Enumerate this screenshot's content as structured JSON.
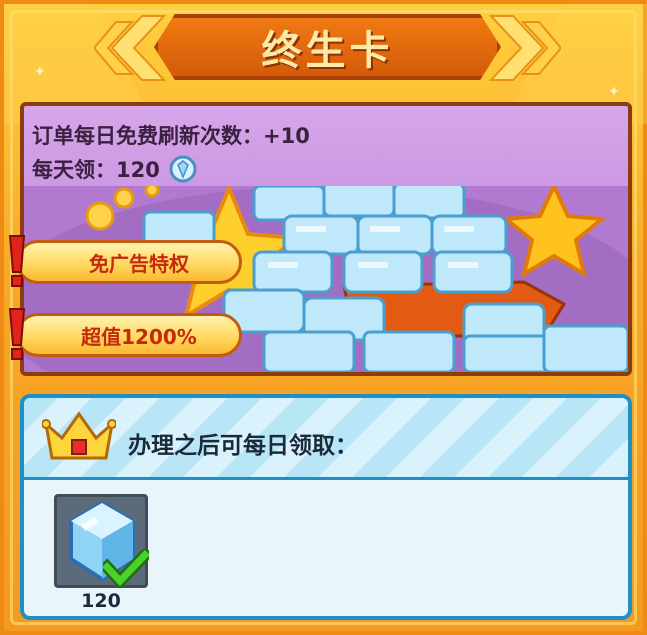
{
  "header": {
    "title": "终生卡"
  },
  "hero": {
    "line1": "订单每日免费刷新次数：+10",
    "line2_label": "每天领：",
    "line2_value": "120",
    "line2_icon": "diamond-icon"
  },
  "badges": [
    {
      "label": "免广告特权"
    },
    {
      "label": "超值1200%"
    }
  ],
  "rewards": {
    "title": "办理之后可每日领取：",
    "items": [
      {
        "icon": "diamond-icon",
        "count": "120",
        "claimed_icon": "checkmark-icon"
      }
    ]
  },
  "colors": {
    "background": "#f7a524",
    "banner": "#e06810",
    "hero_panel": "#c58edc",
    "rewards_border": "#1e90c8",
    "badge_text": "#c6280d"
  }
}
